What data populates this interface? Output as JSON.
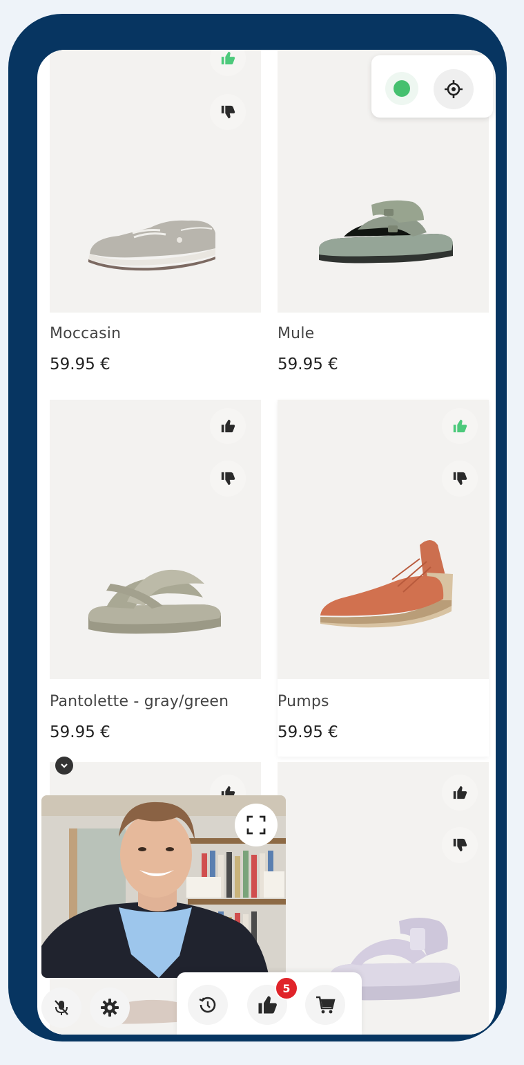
{
  "products": [
    {
      "name": "Moccasin",
      "price": "59.95 €",
      "liked": true
    },
    {
      "name": "Mule",
      "price": "59.95 €",
      "liked": false
    },
    {
      "name": "Pantolette - gray/green",
      "price": "59.95 €",
      "liked": false
    },
    {
      "name": "Pumps",
      "price": "59.95 €",
      "liked": true
    }
  ],
  "toolbar": {
    "likes_badge": "5"
  },
  "icons": {
    "thumbs_up": "thumbs-up-icon",
    "thumbs_down": "thumbs-down-icon",
    "crosshair": "crosshair-icon",
    "fullscreen": "fullscreen-icon",
    "mic_off": "mic-off-icon",
    "settings": "gear-icon",
    "history": "history-icon",
    "likes": "thumbs-up-icon",
    "cart": "cart-icon",
    "collapse": "chevron-down-icon"
  },
  "colors": {
    "frame": "#073561",
    "like_active": "#4cc97b",
    "status_online": "#45c06f",
    "badge": "#e0242a"
  }
}
